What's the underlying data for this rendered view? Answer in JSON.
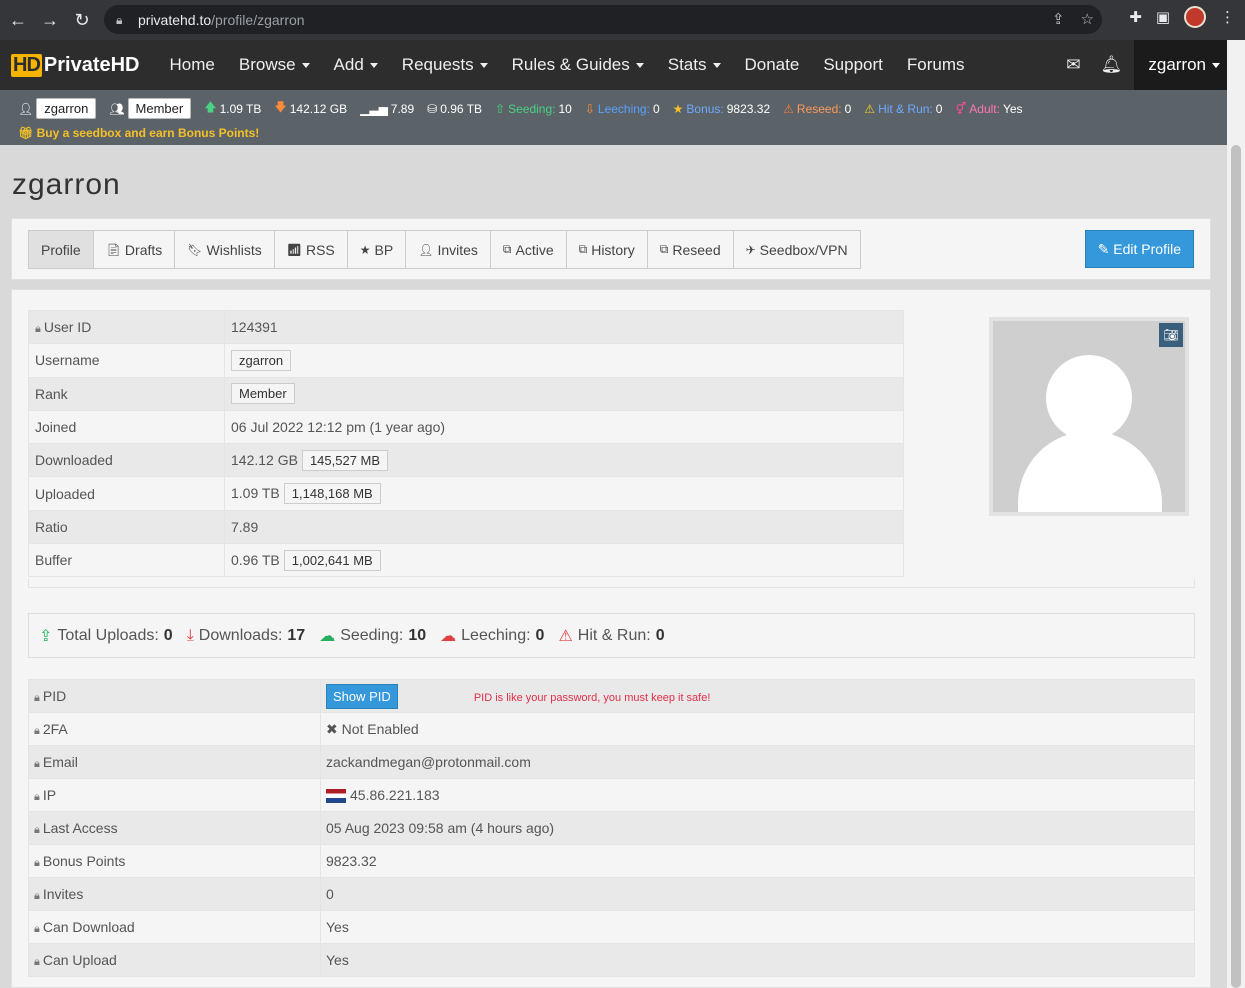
{
  "browser": {
    "url_host": "privatehd.to",
    "url_path": "/profile/zgarron"
  },
  "site": {
    "logo_hd": "HD",
    "logo_text": "PrivateHD",
    "nav": [
      "Home",
      "Browse",
      "Add",
      "Requests",
      "Rules & Guides",
      "Stats",
      "Donate",
      "Support",
      "Forums"
    ],
    "nav_has_caret": [
      false,
      true,
      true,
      true,
      true,
      true,
      false,
      false,
      false
    ],
    "username": "zgarron"
  },
  "statsbar": {
    "user": "zgarron",
    "rank": "Member",
    "uploaded": "1.09 TB",
    "downloaded": "142.12 GB",
    "ratio": "7.89",
    "buffer": "0.96 TB",
    "seeding_label": "Seeding:",
    "seeding": "10",
    "leeching_label": "Leeching:",
    "leeching": "0",
    "bonus_label": "Bonus:",
    "bonus": "9823.32",
    "reseed_label": "Reseed:",
    "reseed": "0",
    "hnr_label": "Hit & Run:",
    "hnr": "0",
    "adult_label": "Adult:",
    "adult": "Yes",
    "seedbox_promo": "Buy a seedbox and earn Bonus Points!"
  },
  "page_title": "zgarron",
  "tabs": [
    "Profile",
    "Drafts",
    "Wishlists",
    "RSS",
    "BP",
    "Invites",
    "Active",
    "History",
    "Reseed",
    "Seedbox/VPN"
  ],
  "edit_profile": "Edit Profile",
  "info": {
    "user_id_label": "User ID",
    "user_id": "124391",
    "username_label": "Username",
    "username": "zgarron",
    "rank_label": "Rank",
    "rank": "Member",
    "joined_label": "Joined",
    "joined": "06 Jul 2022 12:12 pm (1 year ago)",
    "downloaded_label": "Downloaded",
    "downloaded": "142.12 GB",
    "downloaded_mb": "145,527 MB",
    "uploaded_label": "Uploaded",
    "uploaded": "1.09 TB",
    "uploaded_mb": "1,148,168 MB",
    "ratio_label": "Ratio",
    "ratio": "7.89",
    "buffer_label": "Buffer",
    "buffer": "0.96 TB",
    "buffer_mb": "1,002,641 MB"
  },
  "summary": {
    "total_uploads_label": "Total Uploads:",
    "total_uploads": "0",
    "downloads_label": "Downloads:",
    "downloads": "17",
    "seeding_label": "Seeding:",
    "seeding": "10",
    "leeching_label": "Leeching:",
    "leeching": "0",
    "hnr_label": "Hit & Run:",
    "hnr": "0"
  },
  "private": {
    "pid_label": "PID",
    "show_pid": "Show PID",
    "pid_note": "PID is like your password, you must keep it safe!",
    "twofa_label": "2FA",
    "twofa": "Not Enabled",
    "email_label": "Email",
    "email": "zackandmegan@protonmail.com",
    "ip_label": "IP",
    "ip": "45.86.221.183",
    "last_access_label": "Last Access",
    "last_access": "05 Aug 2023 09:58 am (4 hours ago)",
    "bonus_label": "Bonus Points",
    "bonus": "9823.32",
    "invites_label": "Invites",
    "invites": "0",
    "can_download_label": "Can Download",
    "can_download": "Yes",
    "can_upload_label": "Can Upload",
    "can_upload": "Yes"
  },
  "colors": {
    "accent_blue": "#3498db",
    "header_bg": "#2d2d2d",
    "statsbar_bg": "#5b6368",
    "logo_yellow": "#f5b400",
    "seeding_green": "#27ae60",
    "danger_red": "#e04040"
  }
}
